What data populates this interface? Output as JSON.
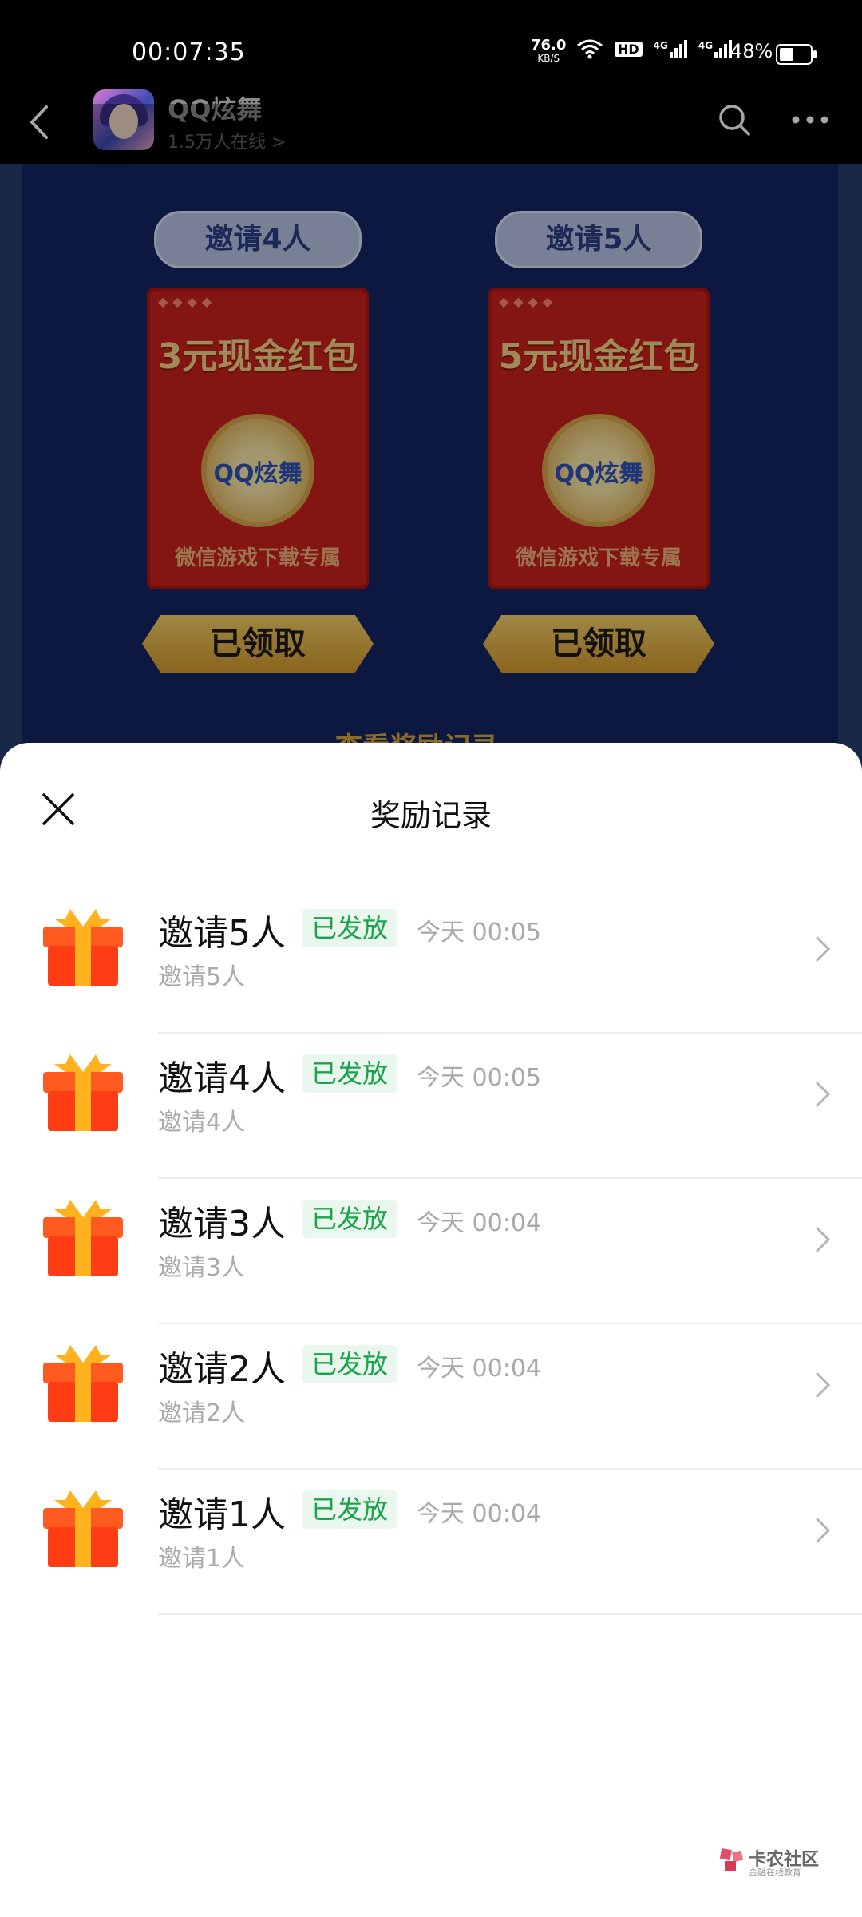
{
  "status_bar": {
    "time": "00:07:35",
    "net_rate": "76.0",
    "net_unit": "KB/S",
    "hd": "HD",
    "sig1": "4G",
    "sig2": "4G",
    "battery": "48%"
  },
  "app_bar": {
    "title": "QQ炫舞",
    "online": "1.5万人在线 >"
  },
  "background": {
    "cards": [
      {
        "pill": "邀请4人",
        "title": "3元现金红包",
        "coin": "QQ炫舞",
        "sub": "微信游戏下载专属",
        "button": "已领取"
      },
      {
        "pill": "邀请5人",
        "title": "5元现金红包",
        "coin": "QQ炫舞",
        "sub": "微信游戏下载专属",
        "button": "已领取"
      }
    ],
    "peek_link": "查看奖励记录"
  },
  "sheet": {
    "title": "奖励记录",
    "records": [
      {
        "title": "邀请5人",
        "badge": "已发放",
        "time": "今天 00:05",
        "sub": "邀请5人"
      },
      {
        "title": "邀请4人",
        "badge": "已发放",
        "time": "今天 00:05",
        "sub": "邀请4人"
      },
      {
        "title": "邀请3人",
        "badge": "已发放",
        "time": "今天 00:04",
        "sub": "邀请3人"
      },
      {
        "title": "邀请2人",
        "badge": "已发放",
        "time": "今天 00:04",
        "sub": "邀请2人"
      },
      {
        "title": "邀请1人",
        "badge": "已发放",
        "time": "今天 00:04",
        "sub": "邀请1人"
      }
    ]
  },
  "watermark": {
    "main": "卡农社区",
    "sub": "金融在线教育"
  },
  "colors": {
    "badge_green": "#1aa34a",
    "badge_bg": "#e9f7ee",
    "redpack": "#c9221c",
    "game_bg": "#142665"
  }
}
